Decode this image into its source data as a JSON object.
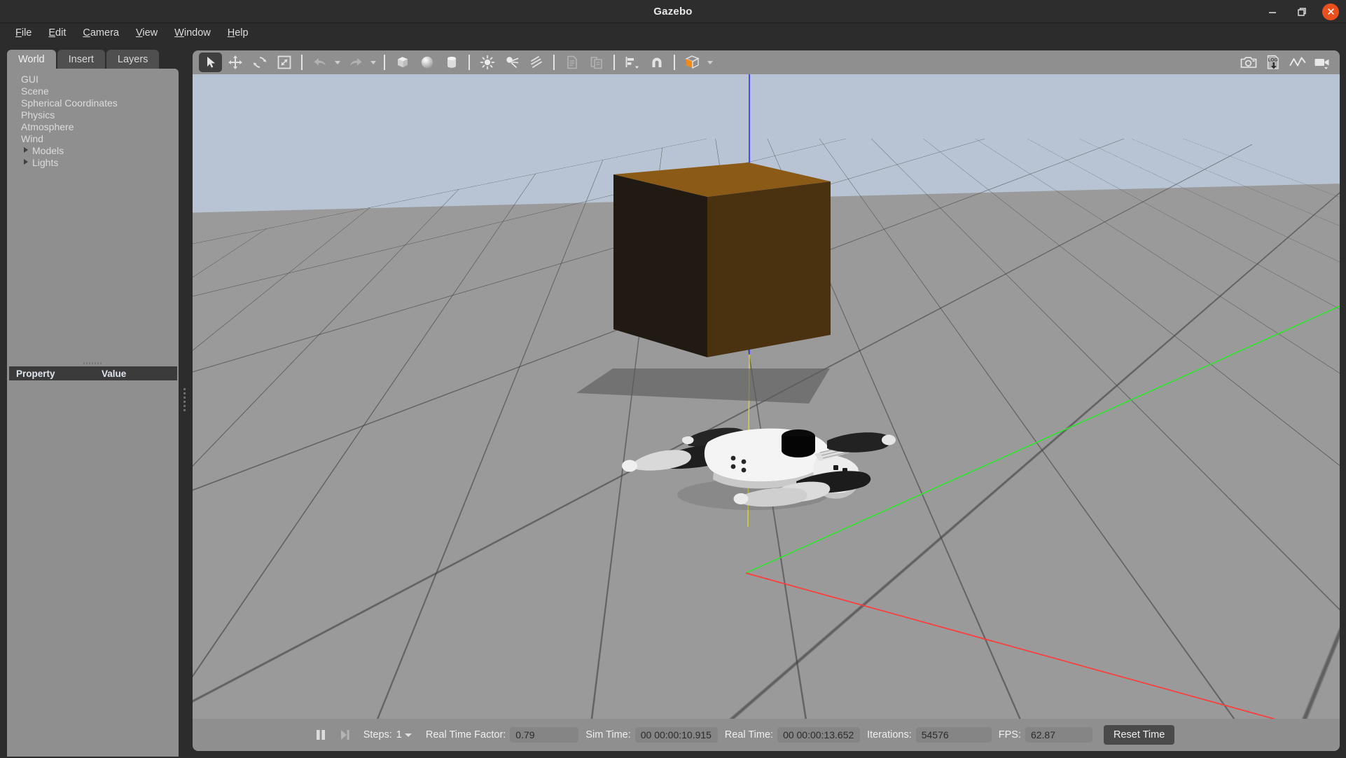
{
  "window": {
    "title": "Gazebo",
    "controls": {
      "minimize": "minimize",
      "maximize": "maximize",
      "close": "close"
    }
  },
  "menubar": {
    "items": [
      {
        "mnemonic": "F",
        "rest": "ile"
      },
      {
        "mnemonic": "E",
        "rest": "dit"
      },
      {
        "mnemonic": "C",
        "rest": "amera"
      },
      {
        "mnemonic": "V",
        "rest": "iew"
      },
      {
        "mnemonic": "W",
        "rest": "indow"
      },
      {
        "mnemonic": "H",
        "rest": "elp"
      }
    ]
  },
  "left_panel": {
    "tabs": [
      {
        "label": "World",
        "active": true
      },
      {
        "label": "Insert",
        "active": false
      },
      {
        "label": "Layers",
        "active": false
      }
    ],
    "tree": [
      {
        "label": "GUI",
        "expandable": false
      },
      {
        "label": "Scene",
        "expandable": false
      },
      {
        "label": "Spherical Coordinates",
        "expandable": false
      },
      {
        "label": "Physics",
        "expandable": false
      },
      {
        "label": "Atmosphere",
        "expandable": false
      },
      {
        "label": "Wind",
        "expandable": false
      },
      {
        "label": "Models",
        "expandable": true
      },
      {
        "label": "Lights",
        "expandable": true
      }
    ],
    "property_table": {
      "col_property": "Property",
      "col_value": "Value",
      "rows": []
    }
  },
  "toolbar": {
    "left_tools": [
      {
        "name": "select-mode",
        "icon": "cursor-arrow-icon",
        "active": true,
        "disabled": false
      },
      {
        "name": "translate-mode",
        "icon": "move-arrows-icon",
        "active": false,
        "disabled": false
      },
      {
        "name": "rotate-mode",
        "icon": "rotate-icon",
        "active": false,
        "disabled": false
      },
      {
        "name": "scale-mode",
        "icon": "scale-icon",
        "active": false,
        "disabled": false
      },
      {
        "name": "undo",
        "icon": "undo-arrow-icon",
        "active": false,
        "disabled": true
      },
      {
        "name": "undo-history",
        "icon": "chevron-down-icon",
        "active": false,
        "disabled": true
      },
      {
        "name": "redo",
        "icon": "redo-arrow-icon",
        "active": false,
        "disabled": true
      },
      {
        "name": "redo-history",
        "icon": "chevron-down-icon",
        "active": false,
        "disabled": true
      },
      {
        "name": "insert-box",
        "icon": "box-icon",
        "active": false,
        "disabled": false
      },
      {
        "name": "insert-sphere",
        "icon": "sphere-icon",
        "active": false,
        "disabled": false
      },
      {
        "name": "insert-cylinder",
        "icon": "cylinder-icon",
        "active": false,
        "disabled": false
      },
      {
        "name": "insert-point-light",
        "icon": "point-light-icon",
        "active": false,
        "disabled": false
      },
      {
        "name": "insert-spot-light",
        "icon": "spot-light-icon",
        "active": false,
        "disabled": false
      },
      {
        "name": "insert-directional-light",
        "icon": "directional-light-icon",
        "active": false,
        "disabled": false
      },
      {
        "name": "copy",
        "icon": "copy-icon",
        "active": false,
        "disabled": true
      },
      {
        "name": "paste",
        "icon": "paste-icon",
        "active": false,
        "disabled": true
      },
      {
        "name": "align",
        "icon": "align-icon",
        "active": false,
        "disabled": false
      },
      {
        "name": "snap",
        "icon": "magnet-icon",
        "active": false,
        "disabled": false
      },
      {
        "name": "view-angle",
        "icon": "view-cube-icon",
        "active": false,
        "disabled": false
      }
    ],
    "right_tools": [
      {
        "name": "screenshot",
        "icon": "camera-icon"
      },
      {
        "name": "log-record",
        "icon": "log-download-icon"
      },
      {
        "name": "plot",
        "icon": "plot-line-icon"
      },
      {
        "name": "video-record",
        "icon": "video-camera-icon"
      }
    ],
    "accent_color": "#f08a1e"
  },
  "statusbar": {
    "pause_button": "pause",
    "step_button": "step-forward",
    "steps_label": "Steps:",
    "steps_value": "1",
    "rtf_label": "Real Time Factor:",
    "rtf_value": "0.79",
    "sim_time_label": "Sim Time:",
    "sim_time_value": "00 00:00:10.915",
    "real_time_label": "Real Time:",
    "real_time_value": "00 00:00:13.652",
    "iterations_label": "Iterations:",
    "iterations_value": "54576",
    "fps_label": "FPS:",
    "fps_value": "62.87",
    "reset_time_label": "Reset Time"
  },
  "scene": {
    "sky_color": "#b8c4d4",
    "ground_color": "#9a9a9a",
    "grid_line_color": "#3c3c3c",
    "axis_x_color": "#ff3b3b",
    "axis_y_color": "#33e033",
    "axis_z_color": "#3b3bff",
    "objects": [
      {
        "name": "wooden-box",
        "type": "box",
        "top_color": "#8a5a16",
        "left_color": "#211a12",
        "right_color": "#4a3211"
      },
      {
        "name": "quadruped-robot",
        "type": "model",
        "body_color": "#f2f2f2",
        "leg_color": "#1c1c1c",
        "sensor_color": "#050505"
      }
    ]
  }
}
